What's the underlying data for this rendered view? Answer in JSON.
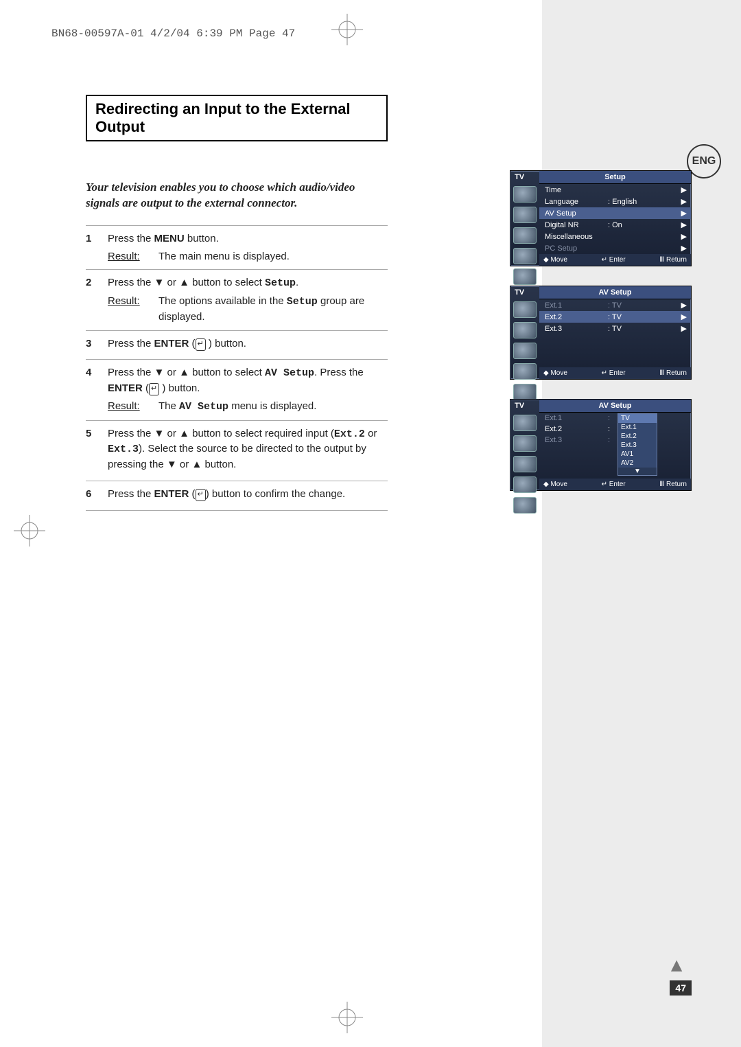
{
  "doc_header": "BN68-00597A-01  4/2/04  6:39 PM  Page 47",
  "lang_badge": "ENG",
  "title": "Redirecting an Input to the External Output",
  "intro": "Your television enables you to choose which audio/video signals are output to the external connector.",
  "labels": {
    "result": "Result:"
  },
  "steps": [
    {
      "num": "1",
      "lines": [
        {
          "parts": [
            "Press the ",
            {
              "b": "MENU"
            },
            " button."
          ]
        },
        {
          "result": "The main menu is displayed."
        }
      ]
    },
    {
      "num": "2",
      "lines": [
        {
          "parts": [
            "Press the ",
            {
              "sym": "▼"
            },
            " or ",
            {
              "sym": "▲"
            },
            " button to select ",
            {
              "m": "Setup"
            },
            "."
          ]
        },
        {
          "result_parts": [
            "The options available in the ",
            {
              "m": "Setup"
            },
            " group are displayed."
          ]
        }
      ]
    },
    {
      "num": "3",
      "lines": [
        {
          "parts": [
            "Press the ",
            {
              "b": "ENTER"
            },
            " (",
            {
              "etr": "↵"
            },
            " ) button."
          ]
        }
      ]
    },
    {
      "num": "4",
      "lines": [
        {
          "parts": [
            "Press the ",
            {
              "sym": "▼"
            },
            " or ",
            {
              "sym": "▲"
            },
            " button to select ",
            {
              "m": "AV Setup"
            },
            ". Press the ",
            {
              "b": "ENTER"
            },
            " (",
            {
              "etr": "↵"
            },
            " ) button."
          ]
        },
        {
          "result_parts": [
            "The ",
            {
              "m": "AV Setup"
            },
            " menu is displayed."
          ]
        }
      ]
    },
    {
      "num": "5",
      "lines": [
        {
          "parts": [
            "Press the ",
            {
              "sym": "▼"
            },
            " or ",
            {
              "sym": "▲"
            },
            " button to select required input (",
            {
              "m": "Ext.2"
            },
            " or ",
            {
              "m": "Ext.3"
            },
            "). Select the source to be directed to the output by  pressing the ",
            {
              "sym": "▼"
            },
            " or ",
            {
              "sym": "▲"
            },
            " button."
          ]
        }
      ]
    },
    {
      "num": "6",
      "lines": [
        {
          "parts": [
            "Press the ",
            {
              "b": "ENTER"
            },
            " (",
            {
              "etr": "↵"
            },
            ") button to confirm the change."
          ]
        }
      ]
    }
  ],
  "osd": {
    "tv": "TV",
    "footer": {
      "move": "Move",
      "enter": "Enter",
      "return": "Return"
    },
    "screens": [
      {
        "title": "Setup",
        "rows": [
          {
            "k": "Time",
            "v": "",
            "ar": "▶"
          },
          {
            "k": "Language",
            "v": ":  English",
            "ar": "▶"
          },
          {
            "k": "AV Setup",
            "v": "",
            "ar": "▶",
            "hl": true
          },
          {
            "k": "Digital NR",
            "v": ":  On",
            "ar": "▶"
          },
          {
            "k": "Miscellaneous",
            "v": "",
            "ar": "▶"
          },
          {
            "k": "PC Setup",
            "v": "",
            "ar": "▶",
            "dim": true
          }
        ]
      },
      {
        "title": "AV Setup",
        "rows": [
          {
            "k": "Ext.1",
            "v": ": TV",
            "ar": "▶",
            "dim": true
          },
          {
            "k": "Ext.2",
            "v": ": TV",
            "ar": "▶",
            "hl": true
          },
          {
            "k": "Ext.3",
            "v": ": TV",
            "ar": "▶"
          }
        ],
        "pad": 3
      },
      {
        "title": "AV Setup",
        "rows": [
          {
            "k": "Ext.1",
            "v": ":",
            "ar": "",
            "dim": true
          },
          {
            "k": "Ext.2",
            "v": ":",
            "ar": ""
          },
          {
            "k": "Ext.3",
            "v": ":",
            "ar": "",
            "dim": true
          }
        ],
        "pad": 3,
        "dropdown": {
          "options": [
            "TV",
            "Ext.1",
            "Ext.2",
            "Ext.3",
            "AV1",
            "AV2"
          ],
          "selected": 0,
          "more": "▼"
        }
      }
    ]
  },
  "page_number": "47"
}
